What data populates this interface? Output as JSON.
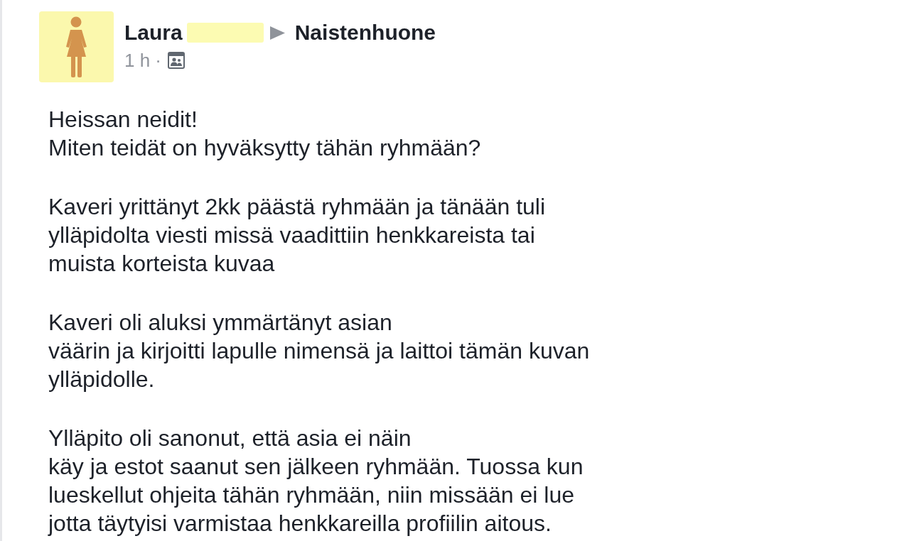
{
  "post": {
    "author": {
      "name": "Laura",
      "surname_redacted": true
    },
    "group": {
      "name": "Naistenhuone"
    },
    "timestamp": "1 h",
    "separator": "·",
    "audience": {
      "kind": "group"
    },
    "paragraphs": [
      "Heissan neidit!\nMiten teidät on hyväksytty tähän ryhmään?",
      "Kaveri yrittänyt 2kk päästä ryhmään ja tänään tuli\nylläpidolta viesti missä vaadittiin henkkareista tai\nmuista korteista kuvaa",
      "Kaveri oli aluksi ymmärtänyt asian\nväärin ja kirjoitti lapulle nimensä ja laittoi tämän kuvan\nylläpidolle.",
      "Ylläpito oli sanonut, että asia ei näin\nkäy ja estot saanut sen jälkeen ryhmään. Tuossa kun\nlueskellut ohjeita tähän ryhmään, niin missään ei lue\njotta täytyisi varmistaa henkkareilla profiilin aitous."
    ]
  }
}
